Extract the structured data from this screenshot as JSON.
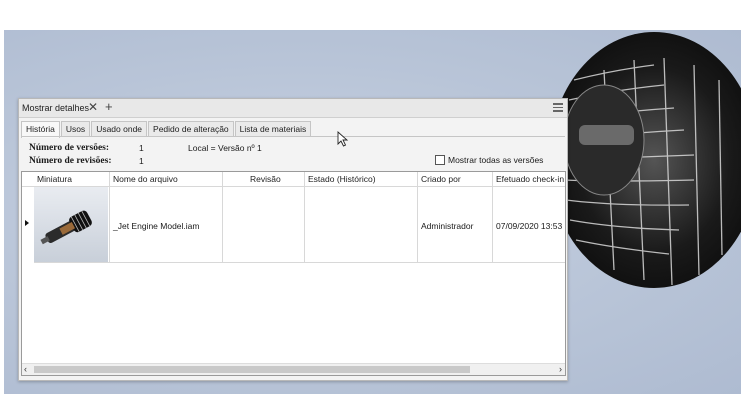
{
  "panel": {
    "title": "Mostrar detalhes",
    "close_glyph": "✕",
    "add_glyph": "+",
    "menu_icon": "hamburger-menu-icon"
  },
  "tabs": [
    {
      "label": "História",
      "active": true
    },
    {
      "label": "Usos",
      "active": false
    },
    {
      "label": "Usado onde",
      "active": false
    },
    {
      "label": "Pedido de alteração",
      "active": false
    },
    {
      "label": "Lista de materiais",
      "active": false
    }
  ],
  "info": {
    "versions_label": "Número de versões:",
    "versions_value": "1",
    "revisions_label": "Número de revisões:",
    "revisions_value": "1",
    "local": "Local = Versão nº 1",
    "show_all_label": "Mostrar todas as versões",
    "show_all_checked": false
  },
  "table": {
    "columns": [
      "Miniatura",
      "Nome do arquivo",
      "Revisão",
      "Estado (Histórico)",
      "Criado por",
      "Efetuado check-in"
    ],
    "rows": [
      {
        "thumbnail": "jet-engine-thumbnail",
        "file_name": "_Jet Engine Model.iam",
        "revision": "",
        "state": "",
        "created_by": "Administrador",
        "checked_in": "07/09/2020 13:53"
      }
    ]
  },
  "scroll": {
    "left_arrow": "‹",
    "right_arrow": "›"
  },
  "colors": {
    "background": "#b9c5d8",
    "panel": "#f3f3f3",
    "engine": "#1c1c1c"
  }
}
